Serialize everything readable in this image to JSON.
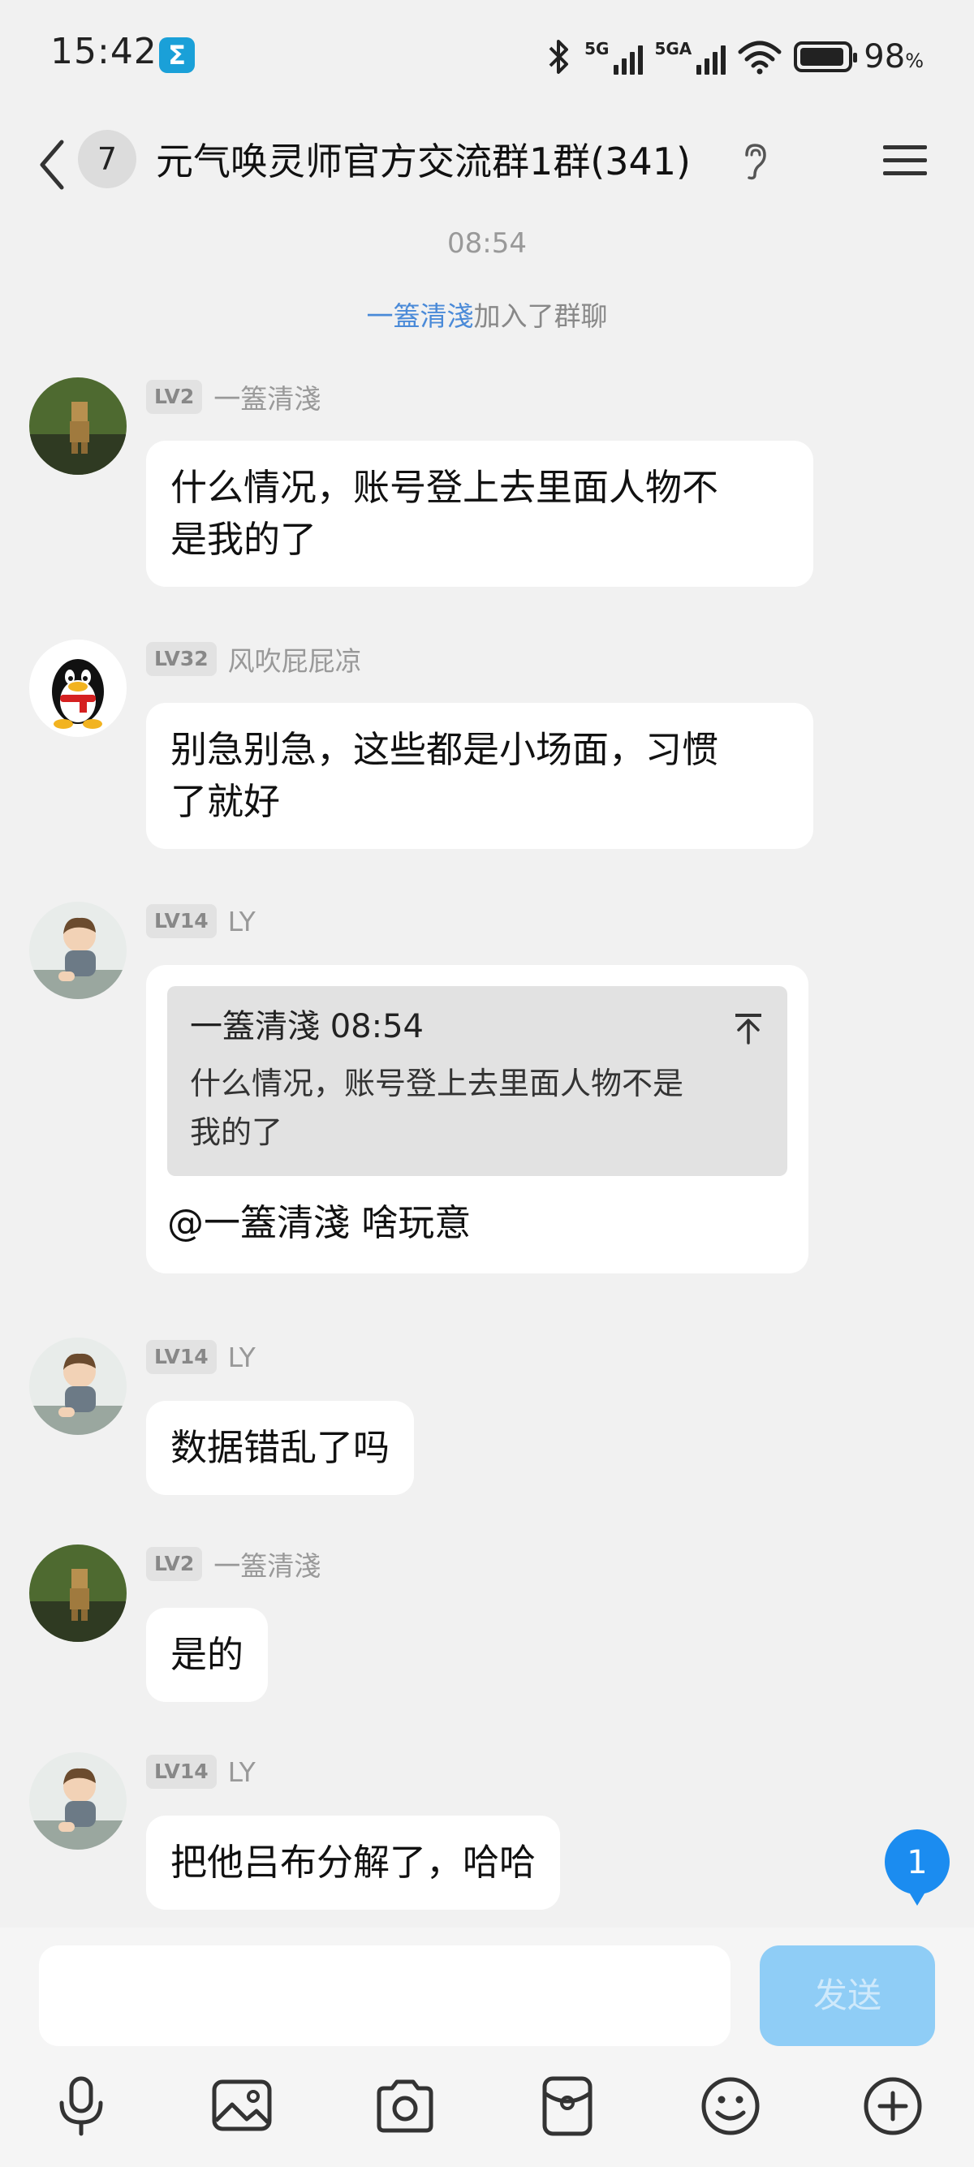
{
  "status_bar": {
    "time": "15:42",
    "app_icon_glyph": "Σ",
    "network1_label": "5G",
    "network2_label": "5GA",
    "battery_percent": "98",
    "battery_unit": "%",
    "battery_level": 0.98
  },
  "header": {
    "unread_count": "7",
    "title": "元气唤灵师官方交流群1群(341)",
    "icons": [
      "back-icon",
      "ear-icon",
      "menu-icon"
    ]
  },
  "chat": {
    "timestamp": "08:54",
    "system_note": {
      "name": "一篕清淺",
      "text": "加入了群聊"
    },
    "messages": [
      {
        "level": "LV2",
        "nickname": "一篕清淺",
        "text_line1": "什么情况，账号登上去里面人物不",
        "text_line2": "是我的了"
      },
      {
        "level": "LV32",
        "nickname": "风吹屁屁凉",
        "text_line1": "别急别急，这些都是小场面，习惯",
        "text_line2": "了就好"
      },
      {
        "level": "LV14",
        "nickname": "LY",
        "quote_header": "一篕清淺 08:54",
        "quote_line1": "什么情况，账号登上去里面人物不是",
        "quote_line2": "我的了",
        "text": "@一篕清淺 啥玩意"
      },
      {
        "level": "LV14",
        "nickname": "LY",
        "text": "数据错乱了吗"
      },
      {
        "level": "LV2",
        "nickname": "一篕清淺",
        "text": "是的"
      },
      {
        "level": "LV14",
        "nickname": "LY",
        "text": "把他吕布分解了，哈哈"
      }
    ],
    "new_message_badge": "1"
  },
  "input_bar": {
    "placeholder": "",
    "send_label": "发送",
    "tools": [
      "microphone-icon",
      "image-icon",
      "camera-icon",
      "red-packet-icon",
      "emoji-icon",
      "plus-icon"
    ]
  },
  "colors": {
    "background": "#f1f1f1",
    "link_blue": "#4a8ad8",
    "send_button": "#8fcdf6",
    "badge_blue": "#1b8cf0"
  }
}
